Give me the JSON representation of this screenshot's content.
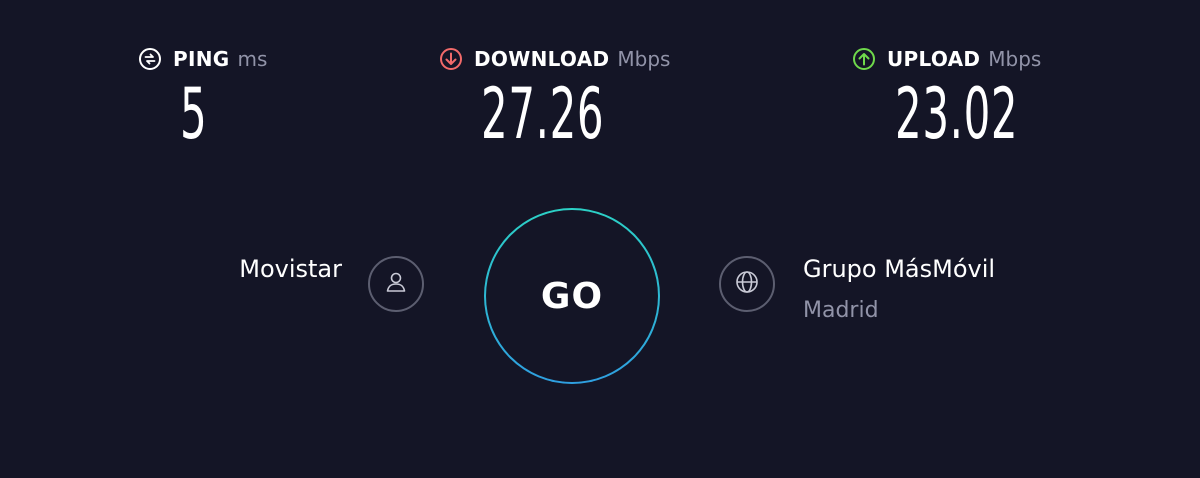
{
  "metrics": {
    "ping": {
      "label": "PING",
      "unit": "ms",
      "value": "5",
      "icon": "ping-icon",
      "icon_color": "#ffffff"
    },
    "download": {
      "label": "DOWNLOAD",
      "unit": "Mbps",
      "value": "27.26",
      "icon": "download-arrow-icon",
      "icon_color": "#f26a6a"
    },
    "upload": {
      "label": "UPLOAD",
      "unit": "Mbps",
      "value": "23.02",
      "icon": "upload-arrow-icon",
      "icon_color": "#6fd94b"
    }
  },
  "go_button": {
    "label": "GO",
    "ring_colors": [
      "#2cd1c6",
      "#2f9fe0"
    ]
  },
  "isp": {
    "name": "Movistar",
    "icon": "user-icon"
  },
  "server": {
    "name": "Grupo MásMóvil",
    "location": "Madrid",
    "icon": "globe-icon"
  },
  "colors": {
    "background": "#141526",
    "text": "#ffffff",
    "muted": "#9193a8"
  }
}
